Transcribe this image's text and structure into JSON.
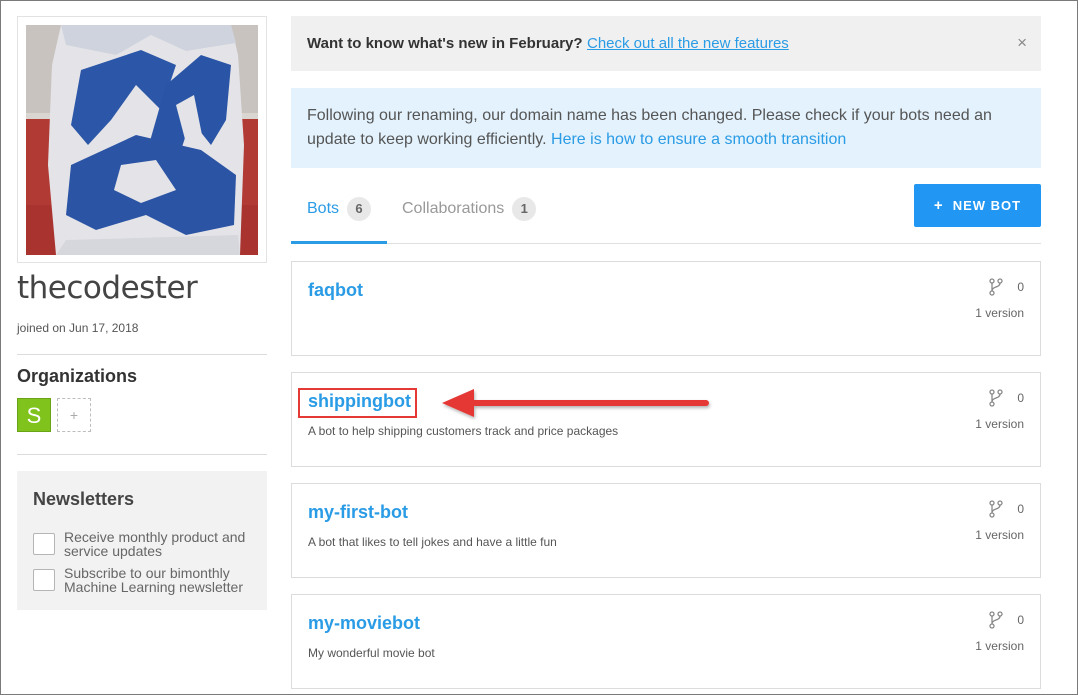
{
  "profile": {
    "username": "thecodester",
    "joined": "joined on Jun 17, 2018"
  },
  "organizations": {
    "title": "Organizations",
    "items": [
      {
        "initial": "S",
        "color": "#7fc31c"
      }
    ],
    "add_label": "+"
  },
  "newsletters": {
    "title": "Newsletters",
    "items": [
      {
        "label": "Receive monthly product and service updates",
        "checked": false
      },
      {
        "label": "Subscribe to our bimonthly Machine Learning newsletter",
        "checked": false
      }
    ]
  },
  "banner": {
    "text": "Want to know what's new in February?",
    "link": "Check out all the new features",
    "close": "×"
  },
  "notice": {
    "text": "Following our renaming, our domain name has been changed. Please check if your bots need an update to keep working efficiently.",
    "link": "Here is how to ensure a smooth transition"
  },
  "tabs": [
    {
      "label": "Bots",
      "count": "6",
      "active": true
    },
    {
      "label": "Collaborations",
      "count": "1",
      "active": false
    }
  ],
  "new_bot_button": "NEW BOT",
  "new_bot_plus": "+",
  "bots": [
    {
      "name": "faqbot",
      "description": "",
      "forks": "0",
      "versions": "1 version"
    },
    {
      "name": "shippingbot",
      "description": "A bot to help shipping customers track and price packages",
      "forks": "0",
      "versions": "1 version"
    },
    {
      "name": "my-first-bot",
      "description": "A bot that likes to tell jokes and have a little fun",
      "forks": "0",
      "versions": "1 version"
    },
    {
      "name": "my-moviebot",
      "description": "My wonderful movie bot",
      "forks": "0",
      "versions": "1 version"
    }
  ],
  "colors": {
    "accent": "#2196f3",
    "link": "#2a9be5",
    "annotation": "#e53935",
    "org_badge": "#7fc31c"
  },
  "icons": {
    "fork": "fork-icon",
    "close": "close-icon",
    "plus": "plus-icon"
  }
}
